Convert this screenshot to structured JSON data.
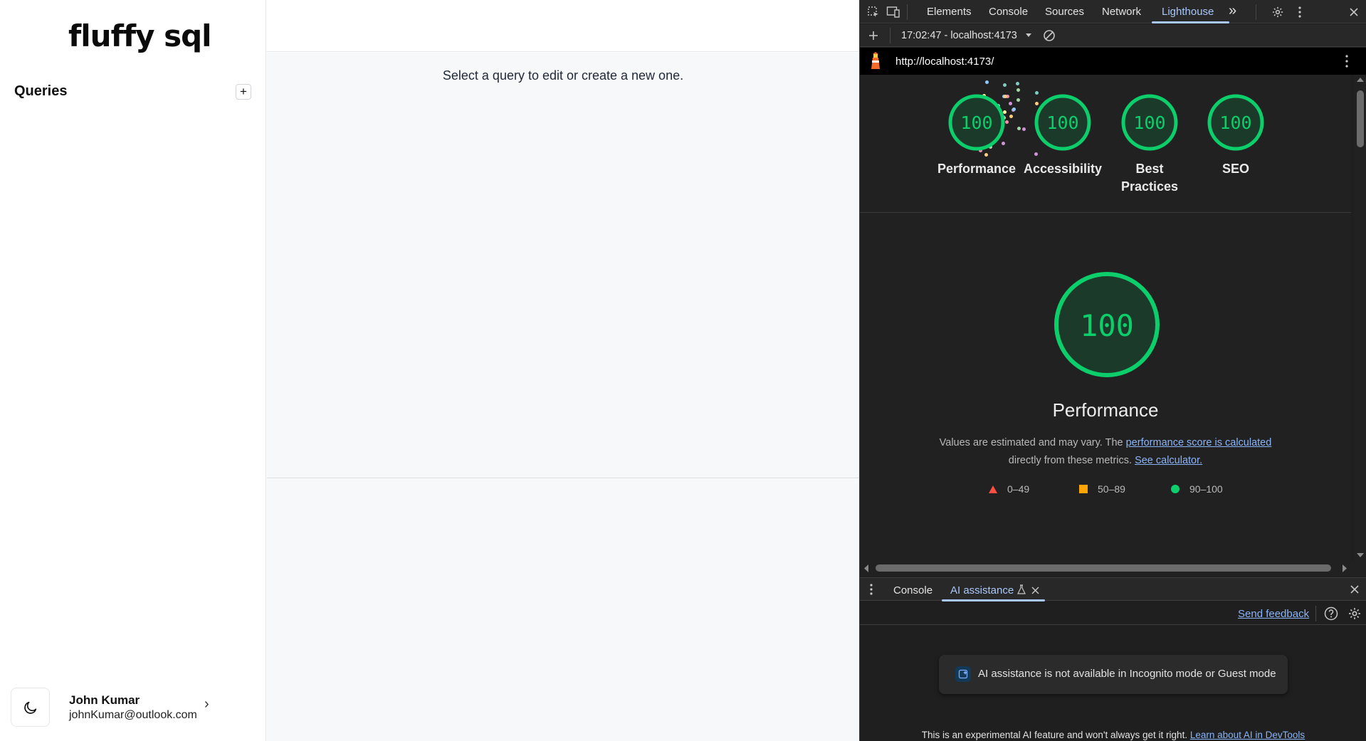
{
  "app": {
    "logo": "fluffy sql",
    "queries_title": "Queries",
    "add_icon": "plus-icon",
    "empty_hint": "Select a query to edit or create a new one.",
    "user": {
      "name": "John Kumar",
      "email": "johnKumar@outlook.com",
      "theme_icon": "moon-icon",
      "chevron": "›"
    }
  },
  "devtools": {
    "tabs": [
      {
        "label": "Elements"
      },
      {
        "label": "Console"
      },
      {
        "label": "Sources"
      },
      {
        "label": "Network"
      },
      {
        "label": "Lighthouse",
        "active": true
      }
    ],
    "more_tabs": "»",
    "report_selector": "17:02:47 - localhost:4173",
    "url": "http://localhost:4173/",
    "categories": [
      {
        "score": "100",
        "label": "Performance"
      },
      {
        "score": "100",
        "label": "Accessibility"
      },
      {
        "score": "100",
        "label": "Best Practices"
      },
      {
        "score": "100",
        "label": "SEO"
      }
    ],
    "main_score": "100",
    "main_title": "Performance",
    "desc": {
      "part1": "Values are estimated and may vary. The ",
      "link1": "performance score is calculated",
      "part2": "directly from these metrics. ",
      "link2": "See calculator."
    },
    "legend": [
      {
        "range": "0–49",
        "color": "#ff4e42",
        "shape": "triangle"
      },
      {
        "range": "50–89",
        "color": "#ffa400",
        "shape": "square"
      },
      {
        "range": "90–100",
        "color": "#0cce6b",
        "shape": "circle"
      }
    ],
    "accent_green": "#0cce6b",
    "drawer": {
      "tabs": [
        {
          "label": "Console"
        },
        {
          "label": "AI assistance",
          "active": true
        }
      ],
      "send_feedback": "Send feedback",
      "notice": "AI assistance is not available in Incognito mode or Guest mode",
      "footer_text": "This is an experimental AI feature and won't always get it right. ",
      "footer_link": "Learn about AI in DevTools"
    }
  }
}
